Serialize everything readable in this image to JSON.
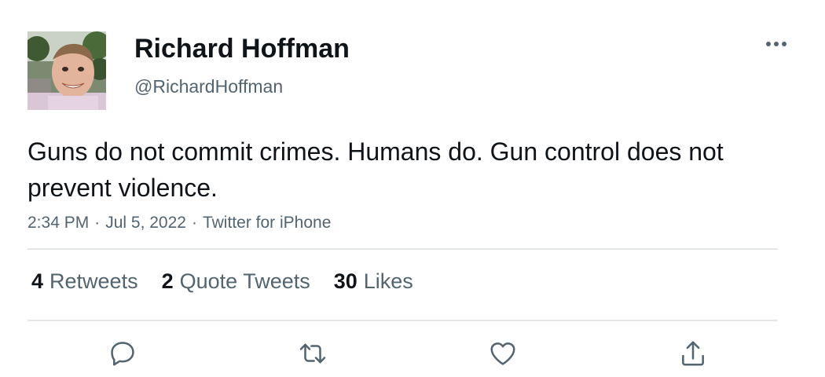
{
  "tweet": {
    "author": {
      "name": "Richard Hoffman",
      "handle": "@RichardHoffman"
    },
    "text": "Guns do not commit crimes. Humans do. Gun control does not prevent violence.",
    "meta": {
      "time": "2:34 PM",
      "date": "Jul 5, 2022",
      "source": "Twitter for iPhone",
      "separator": "·"
    },
    "stats": {
      "retweets": {
        "count": "4",
        "label": "Retweets"
      },
      "quote_tweets": {
        "count": "2",
        "label": "Quote Tweets"
      },
      "likes": {
        "count": "30",
        "label": "Likes"
      }
    },
    "actions": [
      {
        "name": "reply",
        "icon": "reply-icon"
      },
      {
        "name": "retweet",
        "icon": "retweet-icon"
      },
      {
        "name": "like",
        "icon": "heart-icon"
      },
      {
        "name": "share",
        "icon": "share-icon"
      }
    ],
    "more_icon": "more-horizontal-icon"
  },
  "colors": {
    "primary_text": "#0f1419",
    "secondary_text": "#536471",
    "divider": "#e3e7ea",
    "icon": "#536471"
  }
}
